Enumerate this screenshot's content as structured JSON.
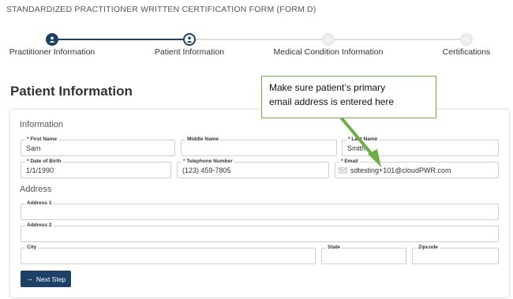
{
  "form_title": "STANDARDIZED PRACTITIONER WRITTEN CERTIFICATION FORM (FORM D)",
  "stepper": {
    "steps": [
      {
        "label": "Practitioner Information",
        "state": "done"
      },
      {
        "label": "Patient Information",
        "state": "current"
      },
      {
        "label": "Medical Condition Information",
        "state": "todo"
      },
      {
        "label": "Certifications",
        "state": "todo"
      }
    ],
    "active_color": "#1e3f66",
    "inactive_color": "#dddddd"
  },
  "page_title": "Patient Information",
  "sections": {
    "information": "Information",
    "address": "Address"
  },
  "fields": {
    "first_name": {
      "label": "* First Name",
      "value": "Sam"
    },
    "middle_name": {
      "label": "Middle Name",
      "value": ""
    },
    "last_name": {
      "label": "* Last Name",
      "value": "Smith"
    },
    "date_of_birth": {
      "label": "* Date of Birth",
      "value": "1/1/1990"
    },
    "telephone": {
      "label": "* Telephone Number",
      "value": "(123) 459-7805"
    },
    "email": {
      "label": "* Email",
      "value": "sdtesting+101@cloudPWR.com",
      "icon": "envelope-icon"
    },
    "address1": {
      "label": "Address 1",
      "value": ""
    },
    "address2": {
      "label": "Address 2",
      "value": ""
    },
    "city": {
      "label": "City",
      "value": ""
    },
    "state": {
      "label": "State",
      "value": ""
    },
    "zipcode": {
      "label": "Zipcode",
      "value": ""
    }
  },
  "next_button": {
    "label": "Next Step",
    "icon": "arrow-right-icon"
  },
  "callout": {
    "line1": "Make sure patient’s primary",
    "line2": "email address is entered here",
    "border_color": "#70ad47",
    "arrow_color": "#70ad47"
  }
}
